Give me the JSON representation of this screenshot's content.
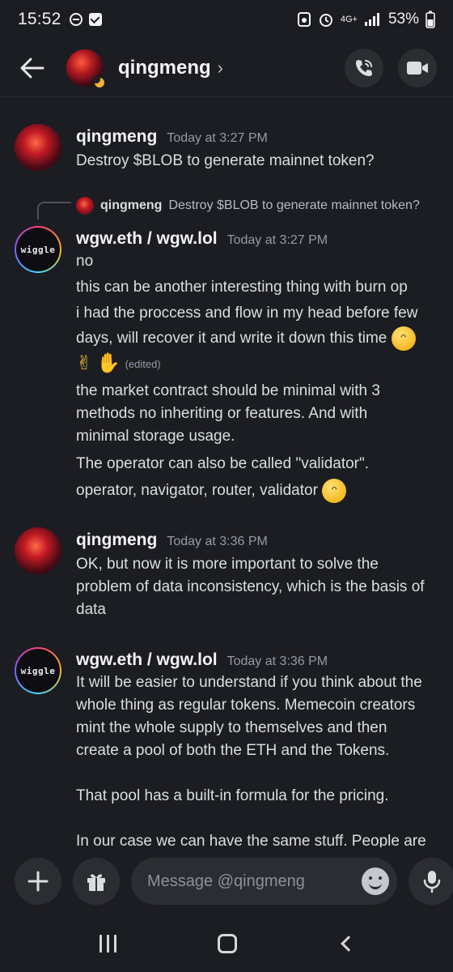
{
  "status_bar": {
    "time": "15:52",
    "network": "4G+",
    "battery": "53%"
  },
  "header": {
    "username": "qingmeng",
    "chevron": "›"
  },
  "messages": [
    {
      "author": "qingmeng",
      "timestamp": "Today at 3:27 PM",
      "lines": [
        "Destroy $BLOB to generate mainnet token?"
      ]
    },
    {
      "reply_to": {
        "author": "qingmeng",
        "text": "Destroy $BLOB to generate mainnet token?"
      },
      "author": "wgw.eth / wgw.lol",
      "avatar_text": "wiggle",
      "timestamp": "Today at 3:27 PM",
      "lines": [
        "no",
        "this can be another interesting thing with burn op",
        "i had the proccess and flow in my head before few",
        "days, will recover it and write it down this time",
        "(edited)",
        "the market contract should be minimal with 3",
        "methods no inheriting or features. And with",
        "minimal storage usage.",
        "The operator can also be called \"validator\".",
        "operator, navigator, router, validator"
      ]
    },
    {
      "author": "qingmeng",
      "timestamp": "Today at 3:36 PM",
      "lines": [
        "OK, but now it is more important to solve the",
        "problem of data inconsistency, which is the basis of",
        "data"
      ]
    },
    {
      "author": "wgw.eth / wgw.lol",
      "avatar_text": "wiggle",
      "timestamp": "Today at 3:36 PM",
      "lines": [
        "It will be easier to understand if you think about the",
        "whole thing as regular tokens. Memecoin creators",
        "mint the whole supply to themselves and then",
        "create a pool of both the ETH and the Tokens.",
        "That pool has a built-in formula for the pricing.",
        "In our case we can have the same stuff. People are"
      ]
    }
  ],
  "composer": {
    "placeholder": "Message @qingmeng"
  },
  "colors": {
    "background": "#1c1d22",
    "button_bg": "#2b2d33",
    "timestamp": "#949ba4",
    "idle_moon": "#f0b232"
  }
}
